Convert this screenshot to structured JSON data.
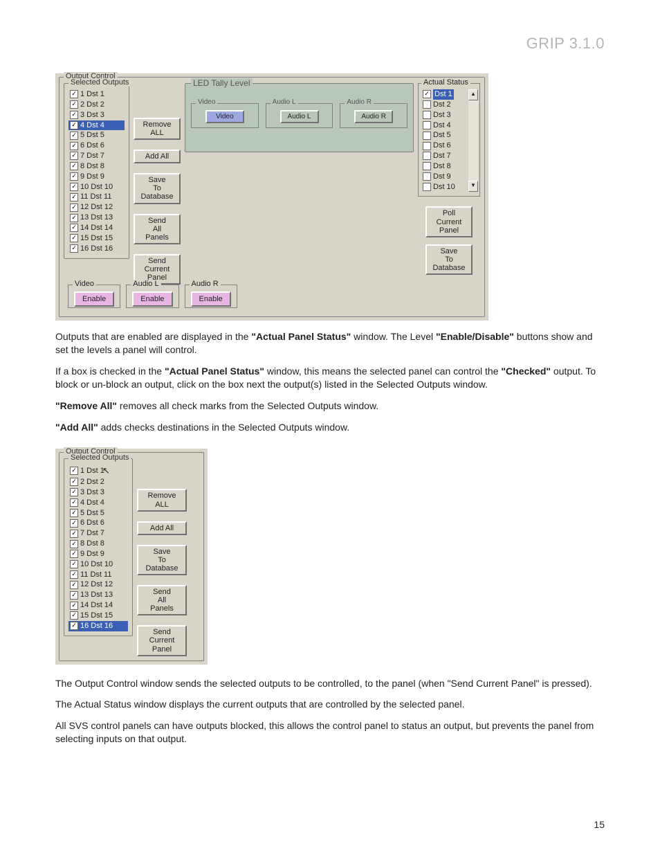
{
  "header": "GRIP 3.1.0",
  "page_number": "15",
  "fig1": {
    "group_label": "Output Control",
    "selected_outputs_label": "Selected Outputs",
    "selected_outputs": [
      {
        "label": "1 Dst 1",
        "checked": true,
        "highlight": false
      },
      {
        "label": "2 Dst 2",
        "checked": true,
        "highlight": false
      },
      {
        "label": "3 Dst 3",
        "checked": true,
        "highlight": false
      },
      {
        "label": "4 Dst 4",
        "checked": true,
        "highlight": true
      },
      {
        "label": "5 Dst 5",
        "checked": true,
        "highlight": false
      },
      {
        "label": "6 Dst 6",
        "checked": true,
        "highlight": false
      },
      {
        "label": "7 Dst 7",
        "checked": true,
        "highlight": false
      },
      {
        "label": "8 Dst 8",
        "checked": true,
        "highlight": false
      },
      {
        "label": "9 Dst 9",
        "checked": true,
        "highlight": false
      },
      {
        "label": "10 Dst 10",
        "checked": true,
        "highlight": false
      },
      {
        "label": "11 Dst 11",
        "checked": true,
        "highlight": false
      },
      {
        "label": "12 Dst 12",
        "checked": true,
        "highlight": false
      },
      {
        "label": "13 Dst 13",
        "checked": true,
        "highlight": false
      },
      {
        "label": "14 Dst 14",
        "checked": true,
        "highlight": false
      },
      {
        "label": "15 Dst 15",
        "checked": true,
        "highlight": false
      },
      {
        "label": "16 Dst 16",
        "checked": true,
        "highlight": false
      }
    ],
    "buttons": {
      "remove_all": "Remove ALL",
      "add_all": "Add All",
      "save_db": "Save\nTo\nDatabase",
      "send_all": "Send\nAll\nPanels",
      "send_current": "Send\nCurrent\nPanel"
    },
    "led": {
      "title": "LED Tally Level",
      "sub": [
        {
          "legend": "Video",
          "label": "Video",
          "active": true
        },
        {
          "legend": "Audio L",
          "label": "Audio L",
          "active": false
        },
        {
          "legend": "Audio R",
          "label": "Audio R",
          "active": false
        }
      ]
    },
    "actual_status_label": "Actual Status",
    "actual_status": [
      {
        "label": "Dst 1",
        "checked": true,
        "highlight": true
      },
      {
        "label": "Dst 2",
        "checked": false,
        "highlight": false
      },
      {
        "label": "Dst 3",
        "checked": false,
        "highlight": false
      },
      {
        "label": "Dst 4",
        "checked": false,
        "highlight": false
      },
      {
        "label": "Dst 5",
        "checked": false,
        "highlight": false
      },
      {
        "label": "Dst 6",
        "checked": false,
        "highlight": false
      },
      {
        "label": "Dst 7",
        "checked": false,
        "highlight": false
      },
      {
        "label": "Dst 8",
        "checked": false,
        "highlight": false
      },
      {
        "label": "Dst 9",
        "checked": false,
        "highlight": false
      },
      {
        "label": "Dst 10",
        "checked": false,
        "highlight": false
      }
    ],
    "status_buttons": {
      "poll": "Poll\nCurrent\nPanel",
      "save_db2": "Save\nTo\nDatabase"
    },
    "bottom_levels": [
      {
        "legend": "Video",
        "label": "Enable"
      },
      {
        "legend": "Audio L",
        "label": "Enable"
      },
      {
        "legend": "Audio R",
        "label": "Enable"
      }
    ]
  },
  "fig2": {
    "group_label": "Output Control",
    "selected_outputs_label": "Selected Outputs",
    "selected_outputs": [
      {
        "label": "1 Dst 1",
        "checked": true,
        "highlight": false
      },
      {
        "label": "2 Dst 2",
        "checked": true,
        "highlight": false
      },
      {
        "label": "3 Dst 3",
        "checked": true,
        "highlight": false
      },
      {
        "label": "4 Dst 4",
        "checked": true,
        "highlight": false
      },
      {
        "label": "5 Dst 5",
        "checked": true,
        "highlight": false
      },
      {
        "label": "6 Dst 6",
        "checked": true,
        "highlight": false
      },
      {
        "label": "7 Dst 7",
        "checked": true,
        "highlight": false
      },
      {
        "label": "8 Dst 8",
        "checked": true,
        "highlight": false
      },
      {
        "label": "9 Dst 9",
        "checked": true,
        "highlight": false
      },
      {
        "label": "10 Dst 10",
        "checked": true,
        "highlight": false
      },
      {
        "label": "11 Dst 11",
        "checked": true,
        "highlight": false
      },
      {
        "label": "12 Dst 12",
        "checked": true,
        "highlight": false
      },
      {
        "label": "13 Dst 13",
        "checked": true,
        "highlight": false
      },
      {
        "label": "14 Dst 14",
        "checked": true,
        "highlight": false
      },
      {
        "label": "15 Dst 15",
        "checked": true,
        "highlight": false
      },
      {
        "label": "16 Dst 16",
        "checked": true,
        "highlight": true
      }
    ],
    "buttons": {
      "remove_all": "Remove ALL",
      "add_all": "Add All",
      "save_db": "Save\nTo\nDatabase",
      "send_all": "Send\nAll\nPanels",
      "send_current": "Send\nCurrent\nPanel"
    }
  },
  "paragraphs": {
    "p1a": "Outputs that are enabled are displayed in the ",
    "p1b": "\"Actual Panel Status\"",
    "p1c": " window. The Level ",
    "p1d": "\"Enable/Disable\"",
    "p1e": " buttons show and set the levels a panel will control.",
    "p2a": "If a box is checked in the ",
    "p2b": "\"Actual Panel Status\"",
    "p2c": " window, this means the selected panel can control the ",
    "p2d": "\"Checked\"",
    "p2e": " output. To block or un-block an output, click on the box next the output(s) listed in the Selected Outputs window.",
    "p3a": "\"Remove All\"",
    "p3b": " removes all check marks from the Selected Outputs window.",
    "p4a": "\"Add All\"",
    "p4b": " adds checks destinations in the Selected Outputs window.",
    "p5": "The Output Control window sends the selected outputs to be controlled, to the panel (when \"Send Current Panel\" is pressed).",
    "p6": "The Actual Status window displays the current outputs that are controlled by the selected panel.",
    "p7": "All SVS control panels can have outputs blocked, this allows the control panel to status an output, but prevents the panel from selecting inputs on that output."
  }
}
